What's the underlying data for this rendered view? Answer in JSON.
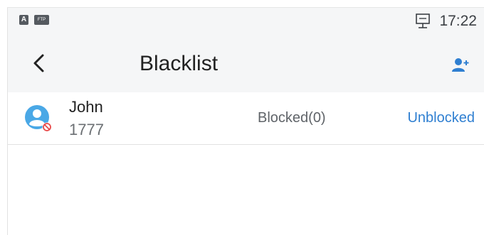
{
  "status_bar": {
    "badge_a": "A",
    "badge_ftp": "FTP",
    "network_icon": "network-monitor-icon",
    "time": "17:22"
  },
  "app_bar": {
    "back_icon": "chevron-left-icon",
    "title": "Blacklist",
    "add_icon": "add-user-icon"
  },
  "blacklist": {
    "entries": [
      {
        "avatar_icon": "contact-avatar-blocked-icon",
        "name": "John",
        "number": "1777",
        "blocked_count": "Blocked(0)",
        "action_label": "Unblocked"
      }
    ]
  },
  "colors": {
    "accent": "#2f7fd1",
    "avatar": "#4aa8e6",
    "blocked_badge": "#e84a4a",
    "bar_background": "#f5f6f7"
  }
}
